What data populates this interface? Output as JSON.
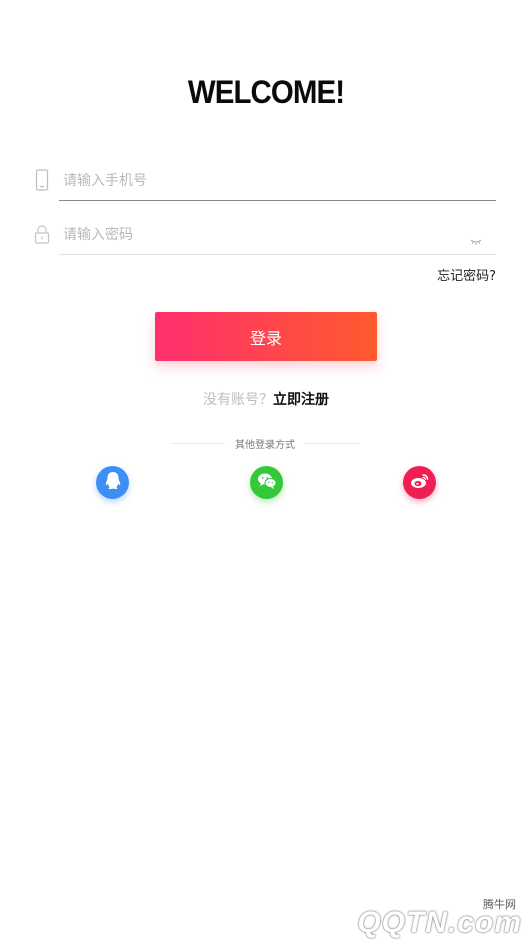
{
  "header": {
    "title": "WELCOME!"
  },
  "form": {
    "phone_placeholder": "请输入手机号",
    "password_placeholder": "请输入密码",
    "forgot_password": "忘记密码?",
    "login_label": "登录"
  },
  "register": {
    "prompt": "没有账号？",
    "link": "立即注册"
  },
  "social": {
    "divider_text": "其他登录方式",
    "providers": [
      {
        "name": "QQ",
        "icon": "qq-icon",
        "color": "#3e8ff5"
      },
      {
        "name": "WeChat",
        "icon": "wechat-icon",
        "color": "#35c93a"
      },
      {
        "name": "Weibo",
        "icon": "weibo-icon",
        "color": "#ee1f52"
      }
    ]
  },
  "watermark": {
    "cn": "腾牛网",
    "en": "QQTN.com"
  },
  "colors": {
    "accent_start": "#ff2f6e",
    "accent_end": "#ff5a2e"
  }
}
